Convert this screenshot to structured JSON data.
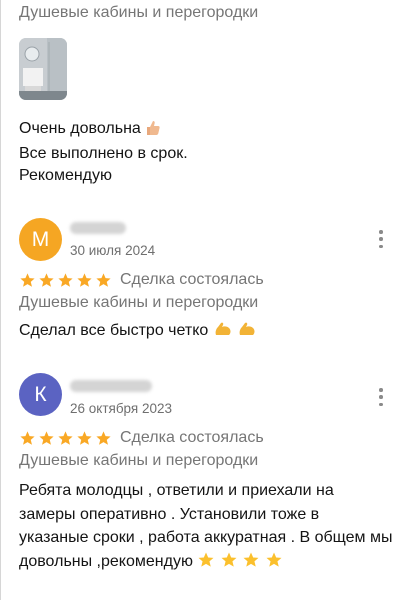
{
  "top_review": {
    "category": "Душевые кабины и перегородки",
    "photo_icon": "shower-photo-thumbnail",
    "lines": [
      "Очень довольна",
      "Все выполнено в срок.",
      "Рекомендую"
    ],
    "line1_emoji": "thumbs-up-icon"
  },
  "reviews": [
    {
      "avatar_letter": "М",
      "avatar_color": "#f5a623",
      "date": "30 июля 2024",
      "rating": 5,
      "deal_label": "Сделка состоялась",
      "category": "Душевые кабины и перегородки",
      "text": "Сделал все быстро четко",
      "trailing_emoji": [
        "flexed-biceps-icon",
        "flexed-biceps-icon"
      ]
    },
    {
      "avatar_letter": "К",
      "avatar_color": "#5b63c2",
      "date": "26 октября 2023",
      "rating": 5,
      "deal_label": "Сделка состоялась",
      "category": "Душевые кабины и перегородки",
      "lines": [
        "Ребята молодцы , ответили и приехали на",
        "замеры оперативно . Установили тоже в",
        "указаные сроки , работа аккуратная . В общем мы",
        "довольны ,рекомендую"
      ],
      "trailing_emoji": [
        "star-icon",
        "star-icon",
        "star-icon",
        "star-icon"
      ]
    }
  ],
  "colors": {
    "star": "#f9a825",
    "muted_text": "#767676"
  }
}
